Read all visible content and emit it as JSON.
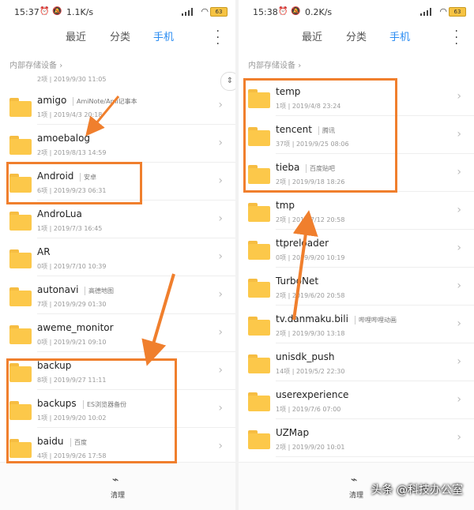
{
  "left": {
    "status": {
      "time": "15:37",
      "speed": "1.1K/s",
      "battery": "63"
    },
    "tabs": [
      "最近",
      "分类",
      "手机"
    ],
    "active_tab": 2,
    "breadcrumb": "内部存储设备",
    "partial_top_meta": "2项 | 2019/9/30 11:05",
    "items": [
      {
        "name": "amigo",
        "alias": "AmiNote/Ami记事本",
        "meta": "1项 | 2019/4/3 20:18"
      },
      {
        "name": "amoebalog",
        "alias": "",
        "meta": "2项 | 2019/8/13 14:59"
      },
      {
        "name": "Android",
        "alias": "安卓",
        "meta": "6项 | 2019/9/23 06:31"
      },
      {
        "name": "AndroLua",
        "alias": "",
        "meta": "1项 | 2019/7/3 16:45"
      },
      {
        "name": "AR",
        "alias": "",
        "meta": "0项 | 2019/7/10 10:39"
      },
      {
        "name": "autonavi",
        "alias": "高德地图",
        "meta": "7项 | 2019/9/29 01:30"
      },
      {
        "name": "aweme_monitor",
        "alias": "",
        "meta": "0项 | 2019/9/21 09:10"
      },
      {
        "name": "backup",
        "alias": "",
        "meta": "8项 | 2019/9/27 11:11"
      },
      {
        "name": "backups",
        "alias": "ES浏览器备份",
        "meta": "1项 | 2019/9/20 10:02"
      },
      {
        "name": "baidu",
        "alias": "百度",
        "meta": "4项 | 2019/9/26 17:58"
      }
    ],
    "bottom_label": "清理"
  },
  "right": {
    "status": {
      "time": "15:38",
      "speed": "0.2K/s",
      "battery": "63"
    },
    "tabs": [
      "最近",
      "分类",
      "手机"
    ],
    "active_tab": 2,
    "breadcrumb": "内部存储设备",
    "items": [
      {
        "name": "temp",
        "alias": "",
        "meta": "1项 | 2019/4/8 23:24"
      },
      {
        "name": "tencent",
        "alias": "腾讯",
        "meta": "37项 | 2019/9/25 08:06"
      },
      {
        "name": "tieba",
        "alias": "百度贴吧",
        "meta": "2项 | 2019/9/18 18:26"
      },
      {
        "name": "tmp",
        "alias": "",
        "meta": "2项 | 2019/7/12 20:58"
      },
      {
        "name": "ttpreloader",
        "alias": "",
        "meta": "0项 | 2019/9/20 10:19"
      },
      {
        "name": "TurboNet",
        "alias": "",
        "meta": "2项 | 2019/6/20 20:58"
      },
      {
        "name": "tv.danmaku.bili",
        "alias": "哔哩哔哩动画",
        "meta": "2项 | 2019/9/30 13:18"
      },
      {
        "name": "unisdk_push",
        "alias": "",
        "meta": "14项 | 2019/5/2 22:30"
      },
      {
        "name": "userexperience",
        "alias": "",
        "meta": "1项 | 2019/7/6 07:00"
      },
      {
        "name": "UZMap",
        "alias": "",
        "meta": "2项 | 2019/9/20 10:01"
      }
    ],
    "bottom_label": "清理"
  },
  "watermark": "头条 @科技办公室",
  "colors": {
    "accent": "#2a8cf2",
    "highlight": "#f07f2d",
    "folder": "#fcc84a"
  },
  "icons": {
    "chevron": "chevron-right-icon",
    "folder": "folder-icon",
    "clean": "broom-icon",
    "more": "more-vert-icon"
  }
}
